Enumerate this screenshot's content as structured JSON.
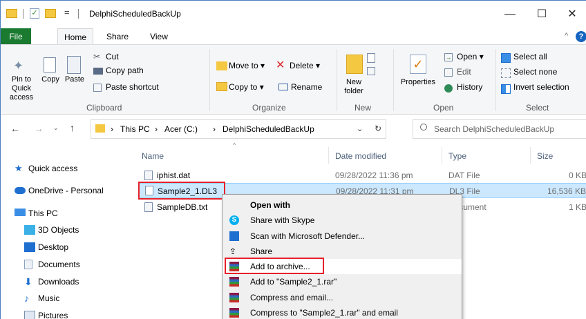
{
  "window": {
    "title": "DelphiScheduledBackUp",
    "qa_arrow": "=",
    "minimize": "—",
    "maximize": "☐",
    "close": "✕"
  },
  "ribbon_tabs": [
    "File",
    "Home",
    "Share",
    "View"
  ],
  "ribbon": {
    "clipboard": {
      "label": "Clipboard",
      "pin": "Pin to Quick access",
      "copy": "Copy",
      "paste": "Paste",
      "cut": "Cut",
      "copy_path": "Copy path",
      "paste_shortcut": "Paste shortcut"
    },
    "organize": {
      "label": "Organize",
      "move_to": "Move to ▾",
      "delete": "Delete ▾",
      "copy_to": "Copy to ▾",
      "rename": "Rename"
    },
    "new": {
      "label": "New",
      "new_folder": "New folder"
    },
    "open": {
      "label": "Open",
      "properties": "Properties",
      "open": "Open ▾",
      "edit": "Edit",
      "history": "History"
    },
    "select": {
      "label": "Select",
      "select_all": "Select all",
      "select_none": "Select none",
      "invert": "Invert selection"
    }
  },
  "address": {
    "segments": [
      "This PC",
      "Acer (C:)",
      "DelphiScheduledBackUp"
    ],
    "search_placeholder": "Search DelphiScheduledBackUp"
  },
  "nav": {
    "quick_access": "Quick access",
    "onedrive": "OneDrive - Personal",
    "this_pc": "This PC",
    "objects3d": "3D Objects",
    "desktop": "Desktop",
    "documents": "Documents",
    "downloads": "Downloads",
    "music": "Music",
    "pictures": "Pictures"
  },
  "columns": {
    "name": "Name",
    "date": "Date modified",
    "type": "Type",
    "size": "Size"
  },
  "files": [
    {
      "name": "iphist.dat",
      "date": "09/28/2022 11:36 pm",
      "type": "DAT File",
      "size": "0 KB"
    },
    {
      "name": "Sample2_1.DL3",
      "date": "09/28/2022 11:31 pm",
      "type": "DL3 File",
      "size": "16,536 KB"
    },
    {
      "name": "SampleDB.txt",
      "date": "",
      "type": "Document",
      "size": "1 KB"
    }
  ],
  "context_menu": {
    "open_with": "Open with",
    "skype": "Share with Skype",
    "defender": "Scan with Microsoft Defender...",
    "share": "Share",
    "add_archive": "Add to archive...",
    "add_rar": "Add to \"Sample2_1.rar\"",
    "compress_email": "Compress and email...",
    "compress_rar_email": "Compress to \"Sample2_1.rar\" and email"
  },
  "colors": {
    "accent": "#1a7a30",
    "highlight": "#e8202a",
    "selection": "#cce8ff"
  }
}
